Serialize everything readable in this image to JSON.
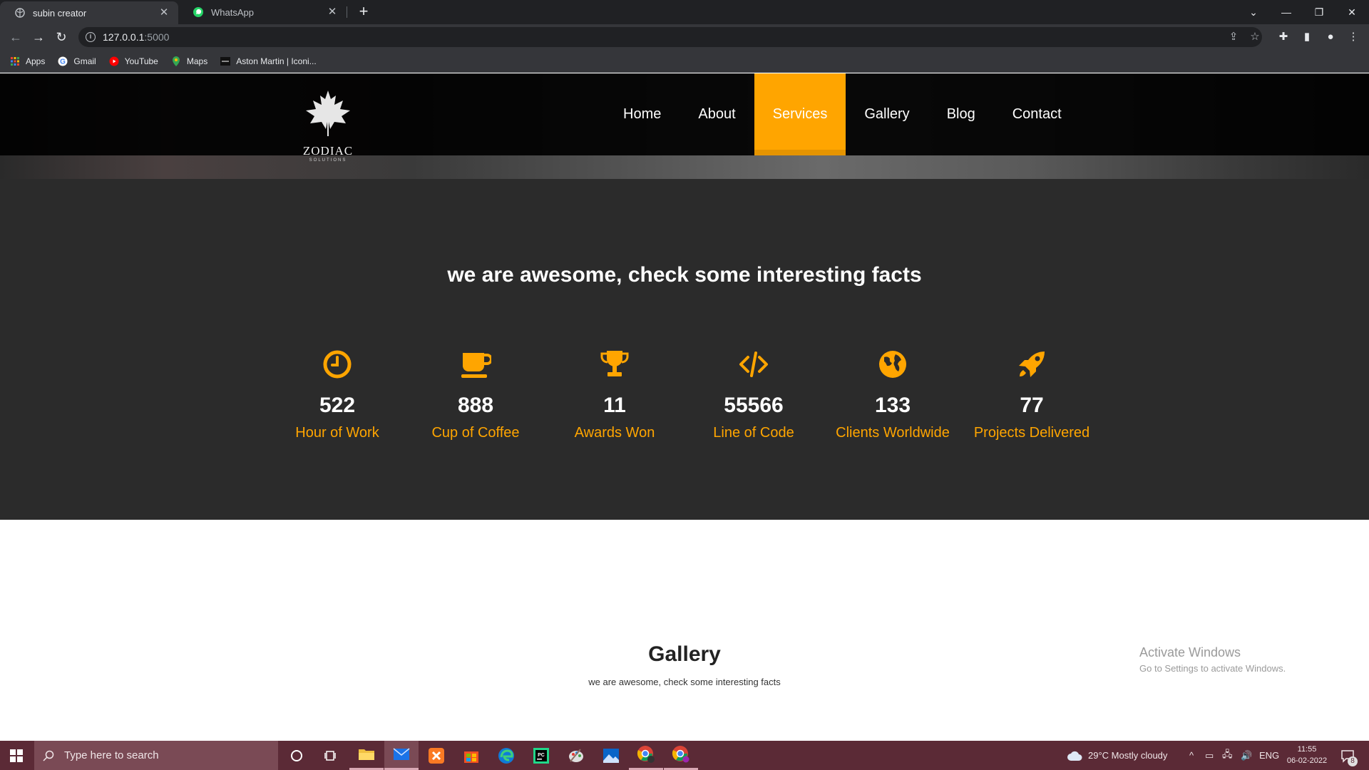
{
  "browser": {
    "tabs": [
      {
        "title": "subin creator",
        "active": true
      },
      {
        "title": "WhatsApp",
        "active": false
      }
    ],
    "url_host": "127.0.0.1",
    "url_port": ":5000",
    "bookmarks": [
      "Apps",
      "Gmail",
      "YouTube",
      "Maps",
      "Aston Martin | Iconi..."
    ]
  },
  "site": {
    "logo": {
      "brand": "ZODIAC",
      "tagline": "SOLUTIONS"
    },
    "menu": [
      "Home",
      "About",
      "Services",
      "Gallery",
      "Blog",
      "Contact"
    ],
    "active_menu": "Services",
    "facts_title": "we are awesome, check some interesting facts",
    "facts": [
      {
        "icon": "clock-icon",
        "value": "522",
        "label": "Hour of Work"
      },
      {
        "icon": "coffee-cup-icon",
        "value": "888",
        "label": "Cup of Coffee"
      },
      {
        "icon": "trophy-icon",
        "value": "11",
        "label": "Awards Won"
      },
      {
        "icon": "code-icon",
        "value": "55566",
        "label": "Line of Code"
      },
      {
        "icon": "globe-icon",
        "value": "133",
        "label": "Clients Worldwide"
      },
      {
        "icon": "rocket-icon",
        "value": "77",
        "label": "Projects Delivered"
      }
    ],
    "gallery_title": "Gallery",
    "gallery_subtitle": "we are awesome, check some interesting facts",
    "accent_color": "#ffa500"
  },
  "watermark": {
    "line1": "Activate Windows",
    "line2": "Go to Settings to activate Windows."
  },
  "taskbar": {
    "search_placeholder": "Type here to search",
    "weather": "29°C  Mostly cloudy",
    "language": "ENG",
    "time": "11:55",
    "date": "06-02-2022",
    "notification_count": "8"
  }
}
